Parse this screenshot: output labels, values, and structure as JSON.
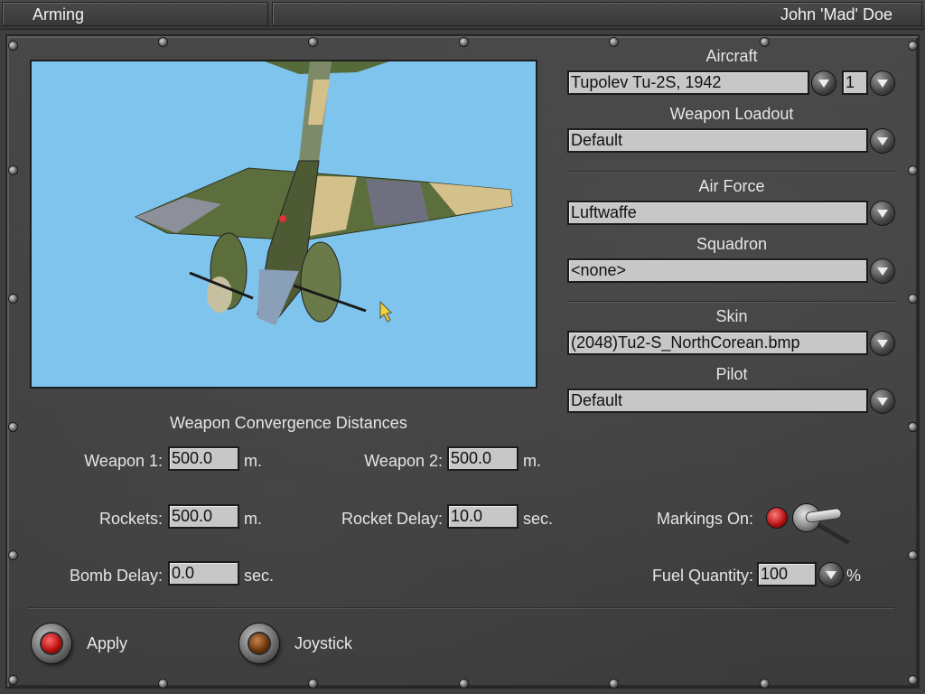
{
  "header": {
    "section": "Arming",
    "pilot_name": "John 'Mad' Doe"
  },
  "aircraft": {
    "label": "Aircraft",
    "value": "Tupolev Tu-2S, 1942",
    "count": "1"
  },
  "loadout": {
    "label": "Weapon Loadout",
    "value": "Default"
  },
  "air_force": {
    "label": "Air Force",
    "value": "Luftwaffe"
  },
  "squadron": {
    "label": "Squadron",
    "value": "<none>"
  },
  "skin": {
    "label": "Skin",
    "value": "(2048)Tu2-S_NorthCorean.bmp"
  },
  "pilot": {
    "label": "Pilot",
    "value": "Default"
  },
  "convergence": {
    "title": "Weapon Convergence Distances",
    "weapon1": {
      "label": "Weapon 1:",
      "value": "500.0",
      "unit": "m."
    },
    "weapon2": {
      "label": "Weapon 2:",
      "value": "500.0",
      "unit": "m."
    },
    "rockets": {
      "label": "Rockets:",
      "value": "500.0",
      "unit": "m."
    },
    "rocket_delay": {
      "label": "Rocket Delay:",
      "value": "10.0",
      "unit": "sec."
    },
    "bomb_delay": {
      "label": "Bomb Delay:",
      "value": "0.0",
      "unit": "sec."
    }
  },
  "markings": {
    "label": "Markings On:"
  },
  "fuel": {
    "label": "Fuel Quantity:",
    "value": "100",
    "unit": "%"
  },
  "buttons": {
    "apply": "Apply",
    "joystick": "Joystick"
  },
  "colors": {
    "sky": "#7fc4ec",
    "field_bg": "#c7c7c7",
    "panel": "#3e3f3e"
  }
}
